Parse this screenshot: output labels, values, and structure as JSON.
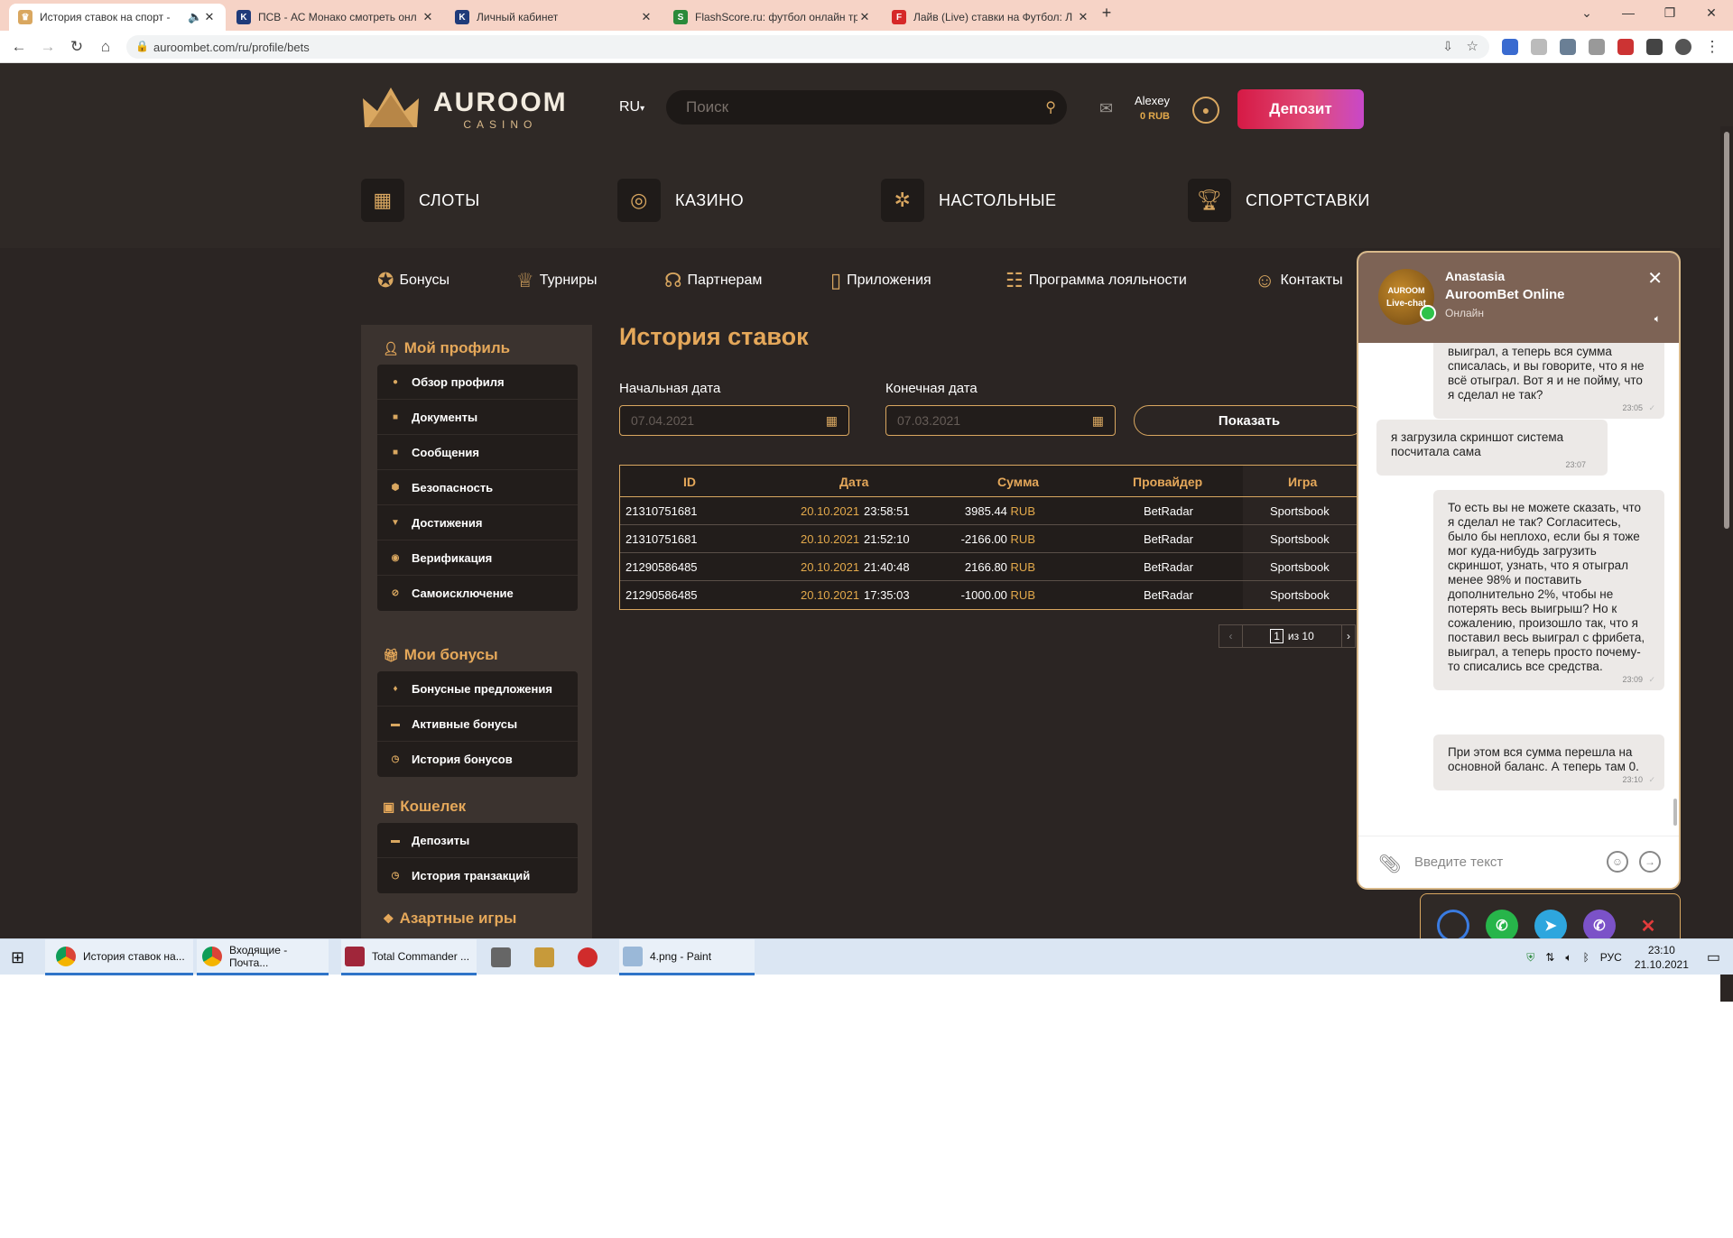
{
  "browser": {
    "tabs": [
      {
        "title": "История ставок на спорт - ",
        "active": true
      },
      {
        "title": "ПСВ - АС Монако смотреть онл"
      },
      {
        "title": "Личный кабинет"
      },
      {
        "title": "FlashScore.ru: футбол онлайн тр"
      },
      {
        "title": "Лайв (Live) ставки на Футбол: Л"
      }
    ],
    "url": "auroombet.com/ru/profile/bets"
  },
  "header": {
    "logo_main": "AUROOM",
    "logo_sub": "CASINO",
    "lang": "RU",
    "search_placeholder": "Поиск",
    "user_name": "Alexey",
    "user_balance": "0 RUB",
    "deposit_label": "Депозит"
  },
  "main_nav": [
    "СЛОТЫ",
    "КАЗИНО",
    "НАСТОЛЬНЫЕ",
    "СПОРТСТАВКИ"
  ],
  "sub_nav": [
    "Бонусы",
    "Турниры",
    "Партнерам",
    "Приложения",
    "Программа лояльности",
    "Контакты"
  ],
  "sidebar": {
    "profile_title": "Мой профиль",
    "profile_items": [
      "Обзор профиля",
      "Документы",
      "Сообщения",
      "Безопасность",
      "Достижения",
      "Верификация",
      "Самоисключение"
    ],
    "bonus_title": "Мои бонусы",
    "bonus_items": [
      "Бонусные предложения",
      "Активные бонусы",
      "История бонусов"
    ],
    "wallet_title": "Кошелек",
    "wallet_items": [
      "Депозиты",
      "История транзакций"
    ],
    "games_title": "Азартные игры"
  },
  "content": {
    "title": "История ставок",
    "start_label": "Начальная дата",
    "start_value": "07.04.2021",
    "end_label": "Конечная дата",
    "end_value": "07.03.2021",
    "show_button": "Показать",
    "table": {
      "headers": [
        "ID",
        "Дата",
        "Сумма",
        "Провайдер",
        "Игра"
      ],
      "rows": [
        {
          "id": "21310751681",
          "date": "20.10.2021",
          "time": "23:58:51",
          "amount": "3985.44",
          "currency": "RUB",
          "provider": "BetRadar",
          "game": "Sportsbook"
        },
        {
          "id": "21310751681",
          "date": "20.10.2021",
          "time": "21:52:10",
          "amount": "-2166.00",
          "currency": "RUB",
          "provider": "BetRadar",
          "game": "Sportsbook"
        },
        {
          "id": "21290586485",
          "date": "20.10.2021",
          "time": "21:40:48",
          "amount": "2166.80",
          "currency": "RUB",
          "provider": "BetRadar",
          "game": "Sportsbook"
        },
        {
          "id": "21290586485",
          "date": "20.10.2021",
          "time": "17:35:03",
          "amount": "-1000.00",
          "currency": "RUB",
          "provider": "BetRadar",
          "game": "Sportsbook"
        }
      ]
    },
    "pager": {
      "current": "1",
      "of": "из 10"
    }
  },
  "chat": {
    "avatar_line1": "AUROOM",
    "avatar_line2": "Live-chat",
    "agent_name": "Anastasia",
    "company": "AuroomBet Online",
    "status": "Онлайн",
    "input_placeholder": "Введите текст",
    "messages": [
      {
        "dir": "out",
        "text": "выиграл, а теперь вся сумма списалась, и вы говорите, что я не всё отыграл. Вот я и не пойму, что я сделал не так?",
        "time": "23:05"
      },
      {
        "dir": "in",
        "text": "я загрузила скриншот система посчитала сама",
        "time": "23:07"
      },
      {
        "dir": "out",
        "text": "То есть вы не можете сказать, что я сделал не так? Согласитесь, было бы неплохо, если бы я тоже мог куда-нибудь загрузить скриншот, узнать, что я отыграл менее 98% и поставить дополнительно 2%, чтобы не потерять весь выигрыш? Но к сожалению, произошло так, что я поставил весь выиграл с фрибета, выиграл, а теперь просто почему-то списались все средства.",
        "time": "23:09"
      },
      {
        "dir": "out",
        "text": "При этом вся сумма перешла на основной баланс. А теперь там 0.",
        "time": "23:10"
      }
    ]
  },
  "taskbar": {
    "items": [
      "История ставок на...",
      "Входящие - Почта...",
      "Total Commander ...",
      "4.png - Paint"
    ],
    "lang": "РУС",
    "time": "23:10",
    "date": "21.10.2021"
  },
  "colors": {
    "accent": "#d9a760",
    "deposit": "#d61a45",
    "bg": "#2b2523"
  }
}
